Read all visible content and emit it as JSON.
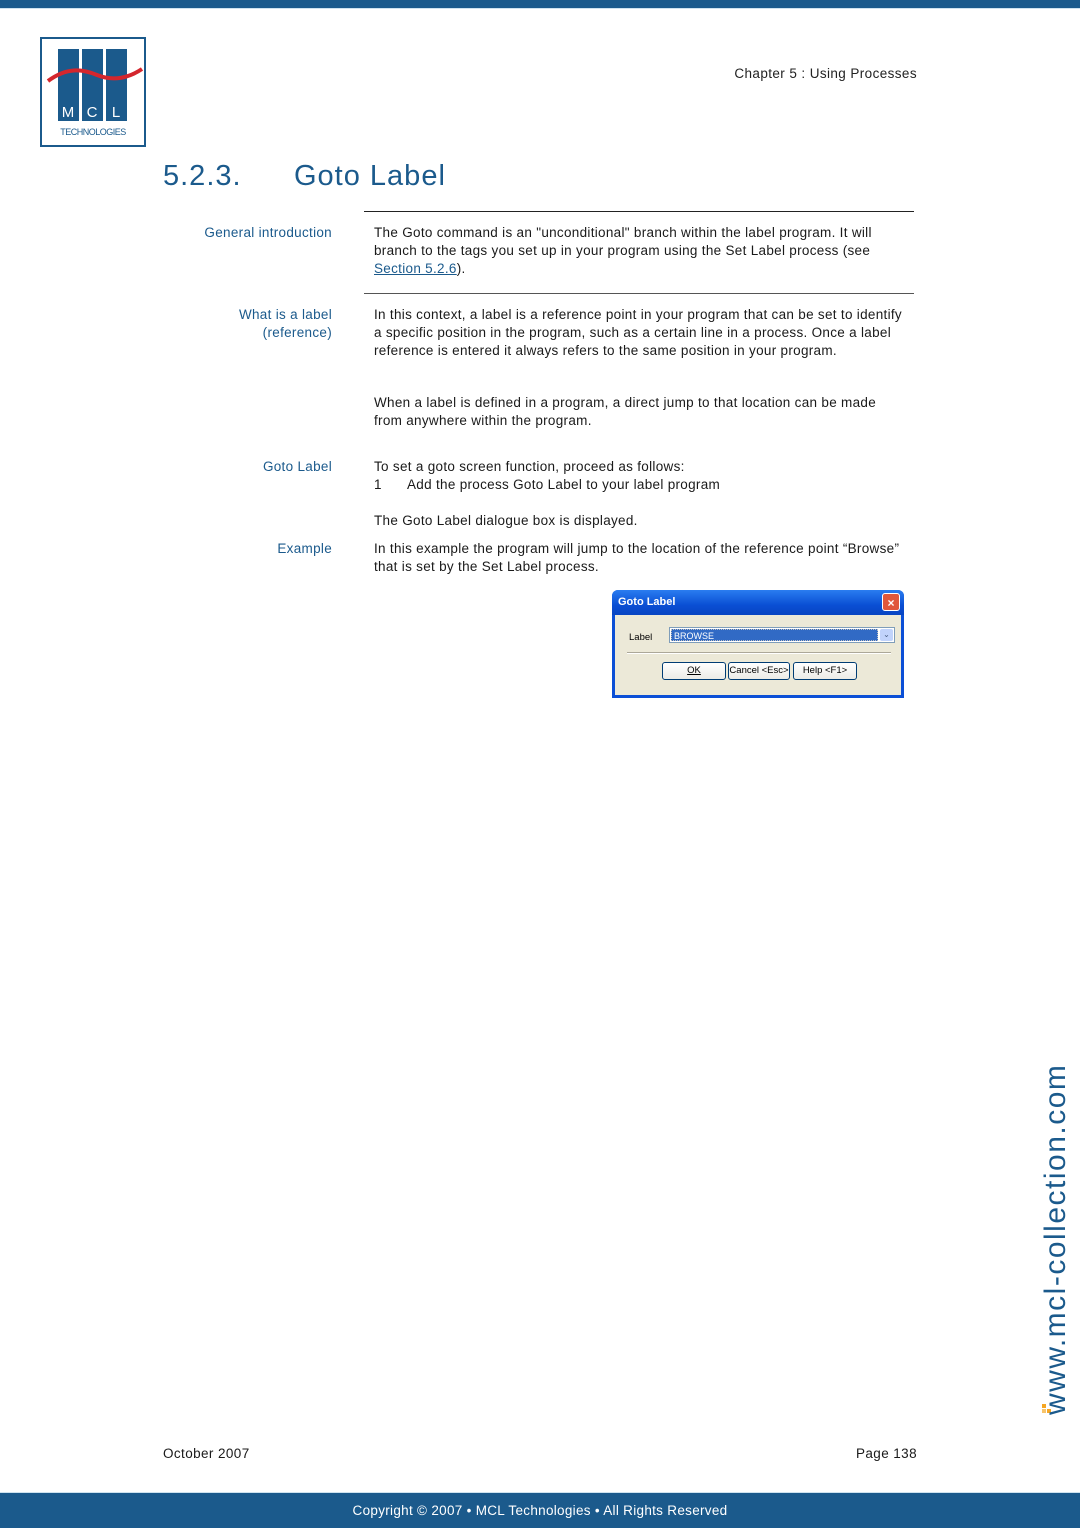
{
  "header": {
    "logo_text": "MCL",
    "logo_subtext": "TECHNOLOGIES",
    "chapter": "Chapter 5 : Using Processes"
  },
  "section": {
    "number": "5.2.3.",
    "title": "Goto Label"
  },
  "blocks": [
    {
      "label": "General introduction",
      "text_before_link": "The Goto command is an \"unconditional\" branch within the label program. It will branch to the tags you set up in your program using the Set Label process (see ",
      "link": "Section 5.2.6",
      "text_after_link": ")."
    },
    {
      "label_line1": "What is a label",
      "label_line2": "(reference)",
      "paragraphs": [
        "In this context, a label is a reference point in your program that can be set to identify a specific position in the program, such as a certain line in a process. Once a label reference is entered it always refers to the same position in your program.",
        "When a label is defined in a program, a direct jump to that location can be made from anywhere within the program."
      ]
    },
    {
      "label": "Goto Label",
      "intro": "To set a goto screen function, proceed as follows:",
      "steps": [
        {
          "number": "1",
          "text": "Add the process Goto Label to your label program"
        }
      ],
      "after": "The Goto Label dialogue box is displayed."
    },
    {
      "label": "Example",
      "text": "In this example the program will jump to the location of the reference point “Browse” that is set by the Set Label process."
    }
  ],
  "dialog": {
    "title": "Goto Label",
    "close_icon": "×",
    "field_label": "Label",
    "field_value": "BROWSE",
    "dropdown_icon": "⌄",
    "buttons": {
      "ok": "OK",
      "cancel": "Cancel <Esc>",
      "help": "Help <F1>"
    }
  },
  "footer": {
    "date": "October 2007",
    "page": "Page 138",
    "copyright": "Copyright © 2007 • MCL Technologies • All Rights Reserved"
  },
  "watermark": "www.mcl-collection.com",
  "colors": {
    "brand_blue": "#1b5a8c",
    "logo_red": "#d4262d",
    "watermark_orange": "#f5a623"
  }
}
